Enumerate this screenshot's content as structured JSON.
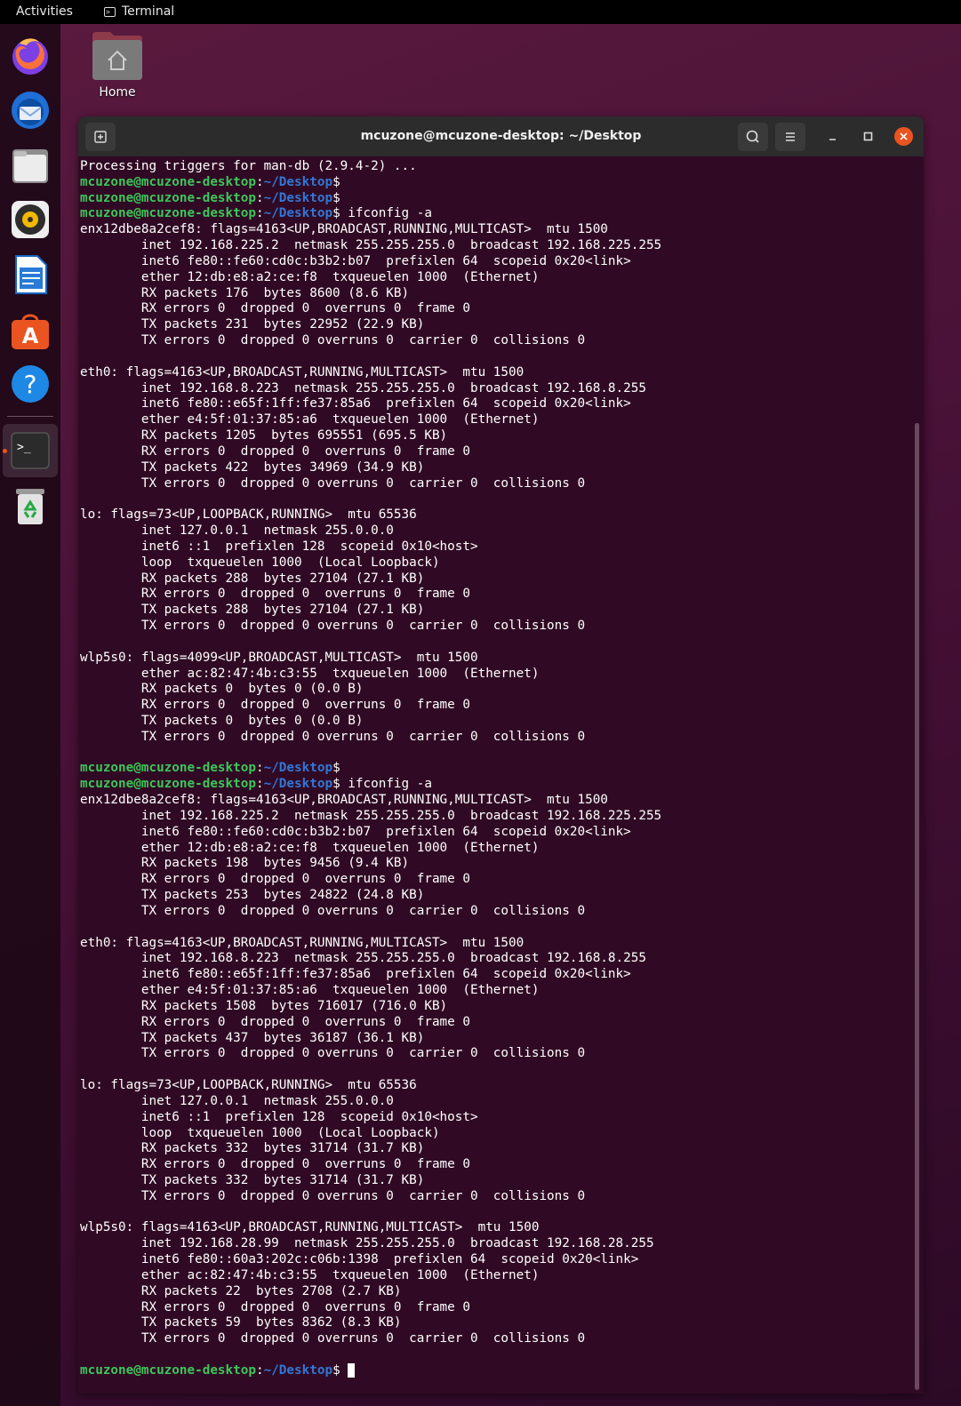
{
  "topbar": {
    "activities": "Activities",
    "app_name": "Terminal"
  },
  "dock": {
    "items": [
      "firefox-icon",
      "thunderbird-icon",
      "files-icon",
      "rhythmbox-icon",
      "writer-icon",
      "software-icon",
      "help-icon",
      "terminal-icon",
      "trash-icon"
    ]
  },
  "desktop": {
    "home_label": "Home"
  },
  "terminal": {
    "title": "mcuzone@mcuzone-desktop: ~/Desktop",
    "prompt_userhost": "mcuzone@mcuzone-desktop",
    "prompt_path": "~/Desktop",
    "lines": [
      {
        "t": "out",
        "text": "Processing triggers for man-db (2.9.4-2) ..."
      },
      {
        "t": "prompt",
        "cmd": ""
      },
      {
        "t": "prompt",
        "cmd": ""
      },
      {
        "t": "prompt",
        "cmd": " ifconfig -a"
      },
      {
        "t": "out",
        "text": "enx12dbe8a2cef8: flags=4163<UP,BROADCAST,RUNNING,MULTICAST>  mtu 1500"
      },
      {
        "t": "out",
        "text": "        inet 192.168.225.2  netmask 255.255.255.0  broadcast 192.168.225.255"
      },
      {
        "t": "out",
        "text": "        inet6 fe80::fe60:cd0c:b3b2:b07  prefixlen 64  scopeid 0x20<link>"
      },
      {
        "t": "out",
        "text": "        ether 12:db:e8:a2:ce:f8  txqueuelen 1000  (Ethernet)"
      },
      {
        "t": "out",
        "text": "        RX packets 176  bytes 8600 (8.6 KB)"
      },
      {
        "t": "out",
        "text": "        RX errors 0  dropped 0  overruns 0  frame 0"
      },
      {
        "t": "out",
        "text": "        TX packets 231  bytes 22952 (22.9 KB)"
      },
      {
        "t": "out",
        "text": "        TX errors 0  dropped 0 overruns 0  carrier 0  collisions 0"
      },
      {
        "t": "out",
        "text": ""
      },
      {
        "t": "out",
        "text": "eth0: flags=4163<UP,BROADCAST,RUNNING,MULTICAST>  mtu 1500"
      },
      {
        "t": "out",
        "text": "        inet 192.168.8.223  netmask 255.255.255.0  broadcast 192.168.8.255"
      },
      {
        "t": "out",
        "text": "        inet6 fe80::e65f:1ff:fe37:85a6  prefixlen 64  scopeid 0x20<link>"
      },
      {
        "t": "out",
        "text": "        ether e4:5f:01:37:85:a6  txqueuelen 1000  (Ethernet)"
      },
      {
        "t": "out",
        "text": "        RX packets 1205  bytes 695551 (695.5 KB)"
      },
      {
        "t": "out",
        "text": "        RX errors 0  dropped 0  overruns 0  frame 0"
      },
      {
        "t": "out",
        "text": "        TX packets 422  bytes 34969 (34.9 KB)"
      },
      {
        "t": "out",
        "text": "        TX errors 0  dropped 0 overruns 0  carrier 0  collisions 0"
      },
      {
        "t": "out",
        "text": ""
      },
      {
        "t": "out",
        "text": "lo: flags=73<UP,LOOPBACK,RUNNING>  mtu 65536"
      },
      {
        "t": "out",
        "text": "        inet 127.0.0.1  netmask 255.0.0.0"
      },
      {
        "t": "out",
        "text": "        inet6 ::1  prefixlen 128  scopeid 0x10<host>"
      },
      {
        "t": "out",
        "text": "        loop  txqueuelen 1000  (Local Loopback)"
      },
      {
        "t": "out",
        "text": "        RX packets 288  bytes 27104 (27.1 KB)"
      },
      {
        "t": "out",
        "text": "        RX errors 0  dropped 0  overruns 0  frame 0"
      },
      {
        "t": "out",
        "text": "        TX packets 288  bytes 27104 (27.1 KB)"
      },
      {
        "t": "out",
        "text": "        TX errors 0  dropped 0 overruns 0  carrier 0  collisions 0"
      },
      {
        "t": "out",
        "text": ""
      },
      {
        "t": "out",
        "text": "wlp5s0: flags=4099<UP,BROADCAST,MULTICAST>  mtu 1500"
      },
      {
        "t": "out",
        "text": "        ether ac:82:47:4b:c3:55  txqueuelen 1000  (Ethernet)"
      },
      {
        "t": "out",
        "text": "        RX packets 0  bytes 0 (0.0 B)"
      },
      {
        "t": "out",
        "text": "        RX errors 0  dropped 0  overruns 0  frame 0"
      },
      {
        "t": "out",
        "text": "        TX packets 0  bytes 0 (0.0 B)"
      },
      {
        "t": "out",
        "text": "        TX errors 0  dropped 0 overruns 0  carrier 0  collisions 0"
      },
      {
        "t": "out",
        "text": ""
      },
      {
        "t": "prompt",
        "cmd": ""
      },
      {
        "t": "prompt",
        "cmd": " ifconfig -a"
      },
      {
        "t": "out",
        "text": "enx12dbe8a2cef8: flags=4163<UP,BROADCAST,RUNNING,MULTICAST>  mtu 1500"
      },
      {
        "t": "out",
        "text": "        inet 192.168.225.2  netmask 255.255.255.0  broadcast 192.168.225.255"
      },
      {
        "t": "out",
        "text": "        inet6 fe80::fe60:cd0c:b3b2:b07  prefixlen 64  scopeid 0x20<link>"
      },
      {
        "t": "out",
        "text": "        ether 12:db:e8:a2:ce:f8  txqueuelen 1000  (Ethernet)"
      },
      {
        "t": "out",
        "text": "        RX packets 198  bytes 9456 (9.4 KB)"
      },
      {
        "t": "out",
        "text": "        RX errors 0  dropped 0  overruns 0  frame 0"
      },
      {
        "t": "out",
        "text": "        TX packets 253  bytes 24822 (24.8 KB)"
      },
      {
        "t": "out",
        "text": "        TX errors 0  dropped 0 overruns 0  carrier 0  collisions 0"
      },
      {
        "t": "out",
        "text": ""
      },
      {
        "t": "out",
        "text": "eth0: flags=4163<UP,BROADCAST,RUNNING,MULTICAST>  mtu 1500"
      },
      {
        "t": "out",
        "text": "        inet 192.168.8.223  netmask 255.255.255.0  broadcast 192.168.8.255"
      },
      {
        "t": "out",
        "text": "        inet6 fe80::e65f:1ff:fe37:85a6  prefixlen 64  scopeid 0x20<link>"
      },
      {
        "t": "out",
        "text": "        ether e4:5f:01:37:85:a6  txqueuelen 1000  (Ethernet)"
      },
      {
        "t": "out",
        "text": "        RX packets 1508  bytes 716017 (716.0 KB)"
      },
      {
        "t": "out",
        "text": "        RX errors 0  dropped 0  overruns 0  frame 0"
      },
      {
        "t": "out",
        "text": "        TX packets 437  bytes 36187 (36.1 KB)"
      },
      {
        "t": "out",
        "text": "        TX errors 0  dropped 0 overruns 0  carrier 0  collisions 0"
      },
      {
        "t": "out",
        "text": ""
      },
      {
        "t": "out",
        "text": "lo: flags=73<UP,LOOPBACK,RUNNING>  mtu 65536"
      },
      {
        "t": "out",
        "text": "        inet 127.0.0.1  netmask 255.0.0.0"
      },
      {
        "t": "out",
        "text": "        inet6 ::1  prefixlen 128  scopeid 0x10<host>"
      },
      {
        "t": "out",
        "text": "        loop  txqueuelen 1000  (Local Loopback)"
      },
      {
        "t": "out",
        "text": "        RX packets 332  bytes 31714 (31.7 KB)"
      },
      {
        "t": "out",
        "text": "        RX errors 0  dropped 0  overruns 0  frame 0"
      },
      {
        "t": "out",
        "text": "        TX packets 332  bytes 31714 (31.7 KB)"
      },
      {
        "t": "out",
        "text": "        TX errors 0  dropped 0 overruns 0  carrier 0  collisions 0"
      },
      {
        "t": "out",
        "text": ""
      },
      {
        "t": "out",
        "text": "wlp5s0: flags=4163<UP,BROADCAST,RUNNING,MULTICAST>  mtu 1500"
      },
      {
        "t": "out",
        "text": "        inet 192.168.28.99  netmask 255.255.255.0  broadcast 192.168.28.255"
      },
      {
        "t": "out",
        "text": "        inet6 fe80::60a3:202c:c06b:1398  prefixlen 64  scopeid 0x20<link>"
      },
      {
        "t": "out",
        "text": "        ether ac:82:47:4b:c3:55  txqueuelen 1000  (Ethernet)"
      },
      {
        "t": "out",
        "text": "        RX packets 22  bytes 2708 (2.7 KB)"
      },
      {
        "t": "out",
        "text": "        RX errors 0  dropped 0  overruns 0  frame 0"
      },
      {
        "t": "out",
        "text": "        TX packets 59  bytes 8362 (8.3 KB)"
      },
      {
        "t": "out",
        "text": "        TX errors 0  dropped 0 overruns 0  carrier 0  collisions 0"
      },
      {
        "t": "out",
        "text": ""
      },
      {
        "t": "prompt",
        "cmd": " ",
        "cursor": true
      }
    ]
  },
  "colors": {
    "terminal_bg": "#300a24",
    "prompt_user": "#3ec65a",
    "prompt_path": "#3277d6",
    "ubuntu_orange": "#e95420"
  }
}
